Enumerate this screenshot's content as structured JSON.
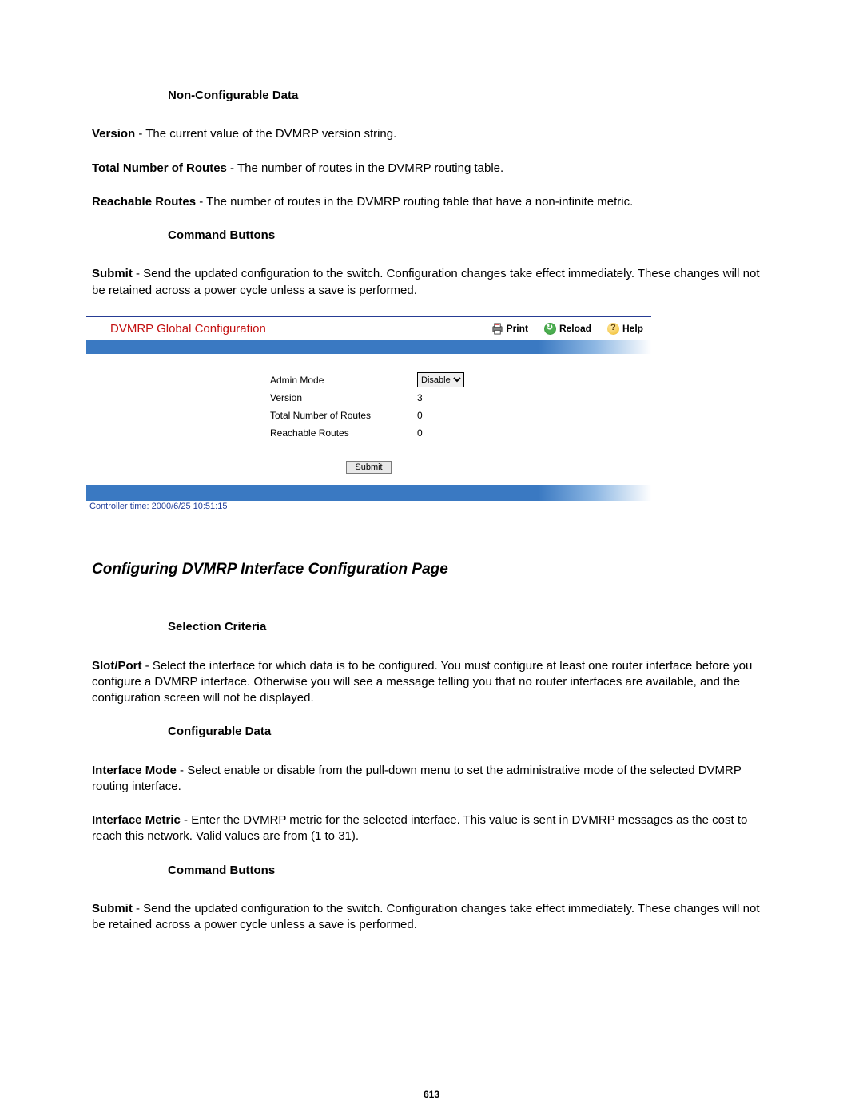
{
  "doc": {
    "heading_nonconf": "Non-Configurable Data",
    "version_term": "Version",
    "version_desc": " - The current value of the DVMRP version string.",
    "total_routes_term": "Total Number of Routes",
    "total_routes_desc": " - The number of routes in the DVMRP routing table.",
    "reachable_term": "Reachable Routes",
    "reachable_desc": " - The number of routes in the DVMRP routing table that have a non-infinite metric.",
    "heading_cmd1": "Command Buttons",
    "submit_term1": "Submit",
    "submit_desc1": " - Send the updated configuration to the switch. Configuration changes take effect immediately. These changes will not be retained across a power cycle unless a save is performed.",
    "section_title": "Configuring DVMRP Interface Configuration Page",
    "heading_selcrit": "Selection Criteria",
    "slotport_term": "Slot/Port",
    "slotport_desc": " - Select the interface for which data is to be configured. You must configure at least one router interface before you configure a DVMRP interface. Otherwise you will see a message telling you that no router interfaces are available, and the configuration screen will not be displayed.",
    "heading_confdata": "Configurable Data",
    "iface_mode_term": "Interface Mode",
    "iface_mode_desc": " - Select enable or disable from the pull-down menu to set the administrative mode of the selected DVMRP routing interface.",
    "iface_metric_term": "Interface Metric",
    "iface_metric_desc": " - Enter the DVMRP metric for the selected interface. This value is sent in DVMRP messages as the cost to reach this network. Valid values are from (1 to 31).",
    "heading_cmd2": "Command Buttons",
    "submit_term2": "Submit",
    "submit_desc2": " - Send the updated configuration to the switch. Configuration changes take effect immediately. These changes will not be retained across a power cycle unless a save is performed.",
    "page_number": "613"
  },
  "shot": {
    "title": "DVMRP Global Configuration",
    "toolbar": {
      "print": "Print",
      "reload": "Reload",
      "help": "Help"
    },
    "fields": {
      "admin_mode_label": "Admin Mode",
      "admin_mode_value": "Disable",
      "version_label": "Version",
      "version_value": "3",
      "total_routes_label": "Total Number of Routes",
      "total_routes_value": "0",
      "reachable_label": "Reachable Routes",
      "reachable_value": "0"
    },
    "submit_label": "Submit",
    "status": "Controller time: 2000/6/25 10:51:15"
  }
}
